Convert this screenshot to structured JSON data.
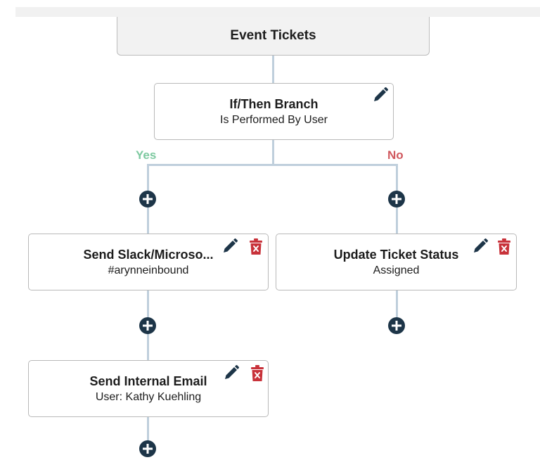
{
  "trigger": {
    "title": "Event Tickets"
  },
  "branch": {
    "title": "If/Then Branch",
    "subtitle": "Is Performed By User"
  },
  "paths": {
    "yes_label": "Yes",
    "no_label": "No"
  },
  "actions": {
    "slack": {
      "title": "Send Slack/Microso...",
      "subtitle": "#arynneinbound"
    },
    "ticket_status": {
      "title": "Update Ticket Status",
      "subtitle": "Assigned"
    },
    "internal_email": {
      "title": "Send Internal Email",
      "subtitle": "User: Kathy Kuehling"
    }
  },
  "icons": {
    "edit": "pencil-icon",
    "delete": "trash-icon",
    "add": "plus-circle-icon"
  },
  "colors": {
    "yes": "#7dc9a0",
    "no": "#d0585e",
    "connector": "#bfcfdc",
    "icon_dark": "#1d3548",
    "delete": "#c8323a"
  }
}
